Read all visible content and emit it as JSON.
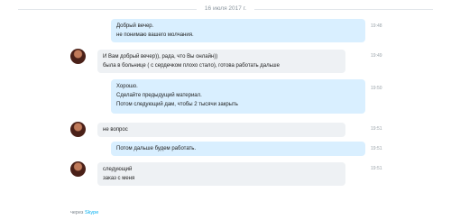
{
  "date_divider": "16 июля 2017 г.",
  "messages": [
    {
      "lines": [
        "Добрый вечер.",
        "не понимаю вашего молчания."
      ],
      "time": "19:48"
    },
    {
      "lines": [
        "И Вам добрый вечер)), рада, что Вы онлайн))",
        "была в больнице ( с сердечком плохо стало), готова работать дальше"
      ],
      "time": "19:49"
    },
    {
      "lines": [
        "Хорошо.",
        "Сделайте предыдущий материал.",
        "Потом следующий дам, чтобы 2 тысячи закрыть"
      ],
      "time": "19:50"
    },
    {
      "lines": [
        "не вопрос"
      ],
      "time": "19:51"
    },
    {
      "lines": [
        "Потом дальше будем работать."
      ],
      "time": "19:51"
    },
    {
      "lines": [
        "следующий",
        "заказ с меня"
      ],
      "time": "19:51"
    }
  ],
  "footer": {
    "prefix": "через",
    "link": "Skype"
  }
}
